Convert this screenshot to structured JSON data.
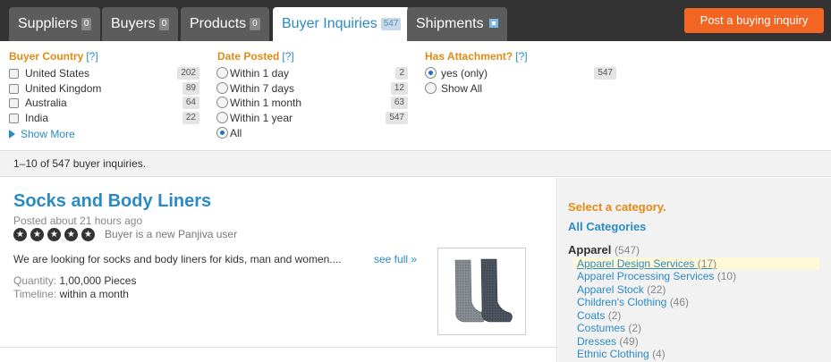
{
  "nav": {
    "tabs": [
      {
        "label": "Suppliers",
        "count": "0"
      },
      {
        "label": "Buyers",
        "count": "0"
      },
      {
        "label": "Products",
        "count": "0"
      },
      {
        "label": "Buyer Inquiries",
        "count": "547",
        "active": true
      },
      {
        "label": "Shipments",
        "icon": "external-link-icon"
      }
    ],
    "post_button": "Post a buying inquiry"
  },
  "filters": {
    "country": {
      "title": "Buyer Country",
      "help": "[?]",
      "options": [
        {
          "label": "United States",
          "count": "202"
        },
        {
          "label": "United Kingdom",
          "count": "89"
        },
        {
          "label": "Australia",
          "count": "64"
        },
        {
          "label": "India",
          "count": "22"
        }
      ],
      "show_more": "Show More"
    },
    "date": {
      "title": "Date Posted",
      "help": "[?]",
      "options": [
        {
          "label": "Within 1 day",
          "count": "2"
        },
        {
          "label": "Within 7 days",
          "count": "12"
        },
        {
          "label": "Within 1 month",
          "count": "63"
        },
        {
          "label": "Within 1 year",
          "count": "547"
        },
        {
          "label": "All",
          "selected": true
        }
      ]
    },
    "attachment": {
      "title": "Has Attachment?",
      "help": "[?]",
      "options": [
        {
          "label": "yes (only)",
          "count": "547",
          "selected": true
        },
        {
          "label": "Show All"
        }
      ]
    }
  },
  "summary": "1–10 of 547 buyer inquiries.",
  "result": {
    "title": "Socks and Body Liners",
    "posted": "Posted about 21 hours ago",
    "buyer_note": "Buyer is a new Panjiva user",
    "rating_stars": 5,
    "description": "We are looking for socks and body liners for kids, man and women....",
    "see_full": "see full »",
    "quantity_label": "Quantity:",
    "quantity_value": "1,00,000 Pieces",
    "timeline_label": "Timeline:",
    "timeline_value": "within a month",
    "image_icon": "socks-image"
  },
  "sidebar": {
    "heading": "Select a category.",
    "all": "All Categories",
    "category": {
      "label": "Apparel",
      "count": "(547)"
    },
    "subcategories": [
      {
        "label": "Apparel Design Services",
        "count": "(17)"
      },
      {
        "label": "Apparel Processing Services",
        "count": "(10)"
      },
      {
        "label": "Apparel Stock",
        "count": "(22)"
      },
      {
        "label": "Children's Clothing",
        "count": "(46)"
      },
      {
        "label": "Coats",
        "count": "(2)"
      },
      {
        "label": "Costumes",
        "count": "(2)"
      },
      {
        "label": "Dresses",
        "count": "(49)"
      },
      {
        "label": "Ethnic Clothing",
        "count": "(4)"
      }
    ]
  },
  "colors": {
    "accent_orange": "#f26522",
    "heading_orange": "#e58a11",
    "link_blue": "#2a8ac8",
    "nav_bg": "#333333"
  }
}
